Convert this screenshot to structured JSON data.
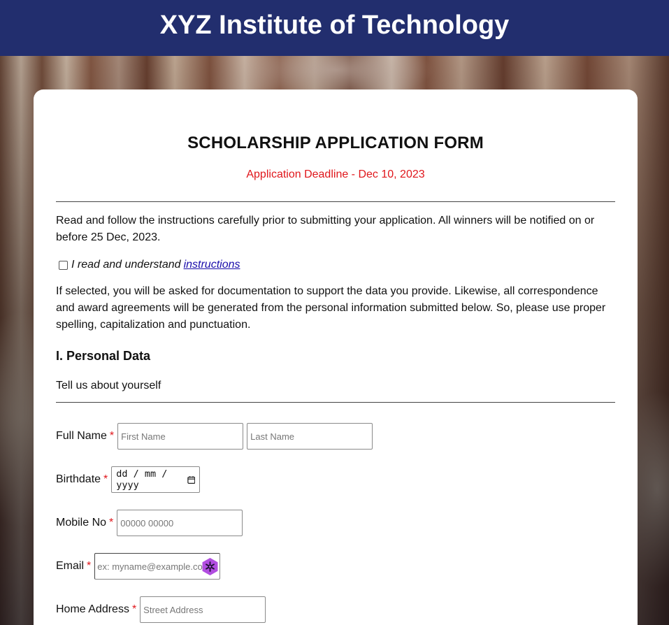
{
  "header": {
    "title": "XYZ Institute of Technology"
  },
  "form": {
    "title": "SCHOLARSHIP APPLICATION FORM",
    "deadline": "Application Deadline - Dec 10, 2023",
    "intro": "Read and follow the instructions carefully prior to submitting your application. All winners will be notified on or before 25 Dec, 2023.",
    "checkbox_label": "I read and understand",
    "checkbox_link": "instructions",
    "checkbox_checked": false,
    "notice": "If selected, you will be asked for documentation to support the data you provide. Likewise, all correspondence and award agreements will be generated from the personal information submitted below. So, please use proper spelling, capitalization and punctuation.",
    "section_title": "I. Personal Data",
    "section_subtitle": "Tell us about yourself",
    "required_marker": "*",
    "fields": {
      "full_name": {
        "label": "Full Name",
        "first_placeholder": "First Name",
        "last_placeholder": "Last Name"
      },
      "birthdate": {
        "label": "Birthdate",
        "placeholder": "dd / mm / yyyy"
      },
      "mobile": {
        "label": "Mobile No",
        "placeholder": "00000 00000"
      },
      "email": {
        "label": "Email",
        "placeholder": "ex: myname@example.com"
      },
      "address": {
        "label": "Home Address",
        "placeholder": "Street Address"
      }
    }
  },
  "colors": {
    "header_bg": "#222e6e",
    "deadline_red": "#e0161b",
    "link_blue": "#1a0dab",
    "extension_purple": "#b14de0"
  },
  "icons": {
    "calendar": "calendar-icon",
    "extension": "password-manager-extension-icon"
  }
}
